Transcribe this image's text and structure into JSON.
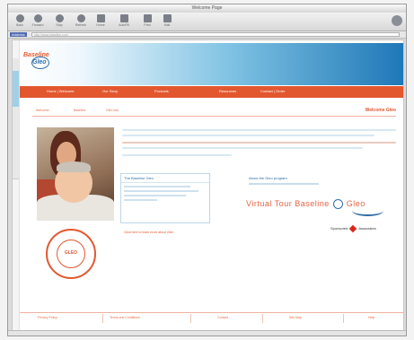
{
  "window": {
    "title": "Welcome Page"
  },
  "toolbar": {
    "buttons": [
      {
        "label": "Back",
        "icon": "back-arrow-icon"
      },
      {
        "label": "Forward",
        "icon": "forward-arrow-icon"
      },
      {
        "label": "Stop",
        "icon": "stop-icon"
      },
      {
        "label": "Refresh",
        "icon": "refresh-icon"
      },
      {
        "label": "Home",
        "icon": "home-icon"
      },
      {
        "label": "AutoFill",
        "icon": "autofill-icon"
      },
      {
        "label": "Print",
        "icon": "print-icon"
      },
      {
        "label": "Mail",
        "icon": "mail-icon"
      }
    ]
  },
  "address": {
    "label": "Address",
    "url": "http://www.baseline.com"
  },
  "site": {
    "logo_line1": "Baseline",
    "logo_line2": "Gleo",
    "nav": [
      "Home | Welcome",
      "Our Story",
      "Products",
      "Resources",
      "Contact | Order"
    ],
    "subnav": [
      "Welcome",
      "Baseline",
      "Gleo Info"
    ],
    "page_title": "Welcome Gleo",
    "infobox_title": "The Baseline Gleo",
    "right_link": "About the Gleo program",
    "tagline_pre": "Virtual Tour Baseline",
    "tagline_post": "Gleo",
    "sponsor_left": "Sponsored",
    "sponsor_right": "Associates",
    "small_link": "Click here to learn more about Gleo",
    "badge_text": "GLEO",
    "footer": [
      "Privacy Policy",
      "Terms and Conditions",
      "Contact",
      "Site Map",
      "Help"
    ]
  },
  "colors": {
    "accent": "#e3572f",
    "brand_blue": "#2e6da8",
    "banner_end": "#1f78b7"
  }
}
